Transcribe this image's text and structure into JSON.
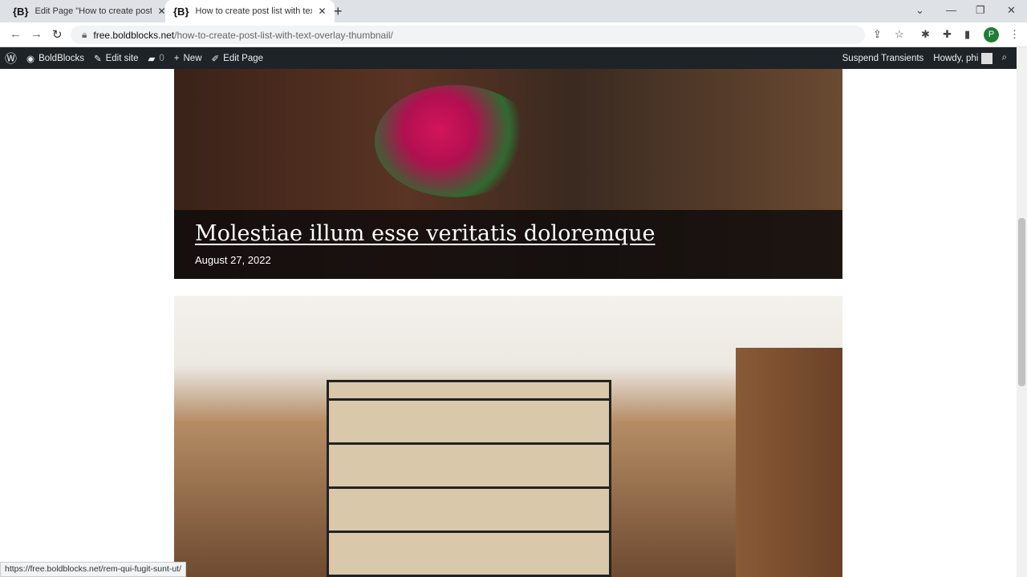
{
  "browser": {
    "tabs": [
      {
        "title": "Edit Page \"How to create post list",
        "active": false
      },
      {
        "title": "How to create post list with text overlay",
        "active": true
      }
    ],
    "url_domain": "free.boldblocks.net",
    "url_path": "/how-to-create-post-list-with-text-overlay-thumbnail/",
    "profile_initial": "P",
    "status_url": "https://free.boldblocks.net/rem-qui-fugit-sunt-ut/"
  },
  "wpbar": {
    "site": "BoldBlocks",
    "edit_site": "Edit site",
    "comments": "0",
    "new": "New",
    "edit_page": "Edit Page",
    "suspend": "Suspend Transients",
    "howdy": "Howdy, phi"
  },
  "posts": [
    {
      "title": "Molestiae illum esse veritatis doloremque",
      "date": "August 27, 2022"
    }
  ]
}
